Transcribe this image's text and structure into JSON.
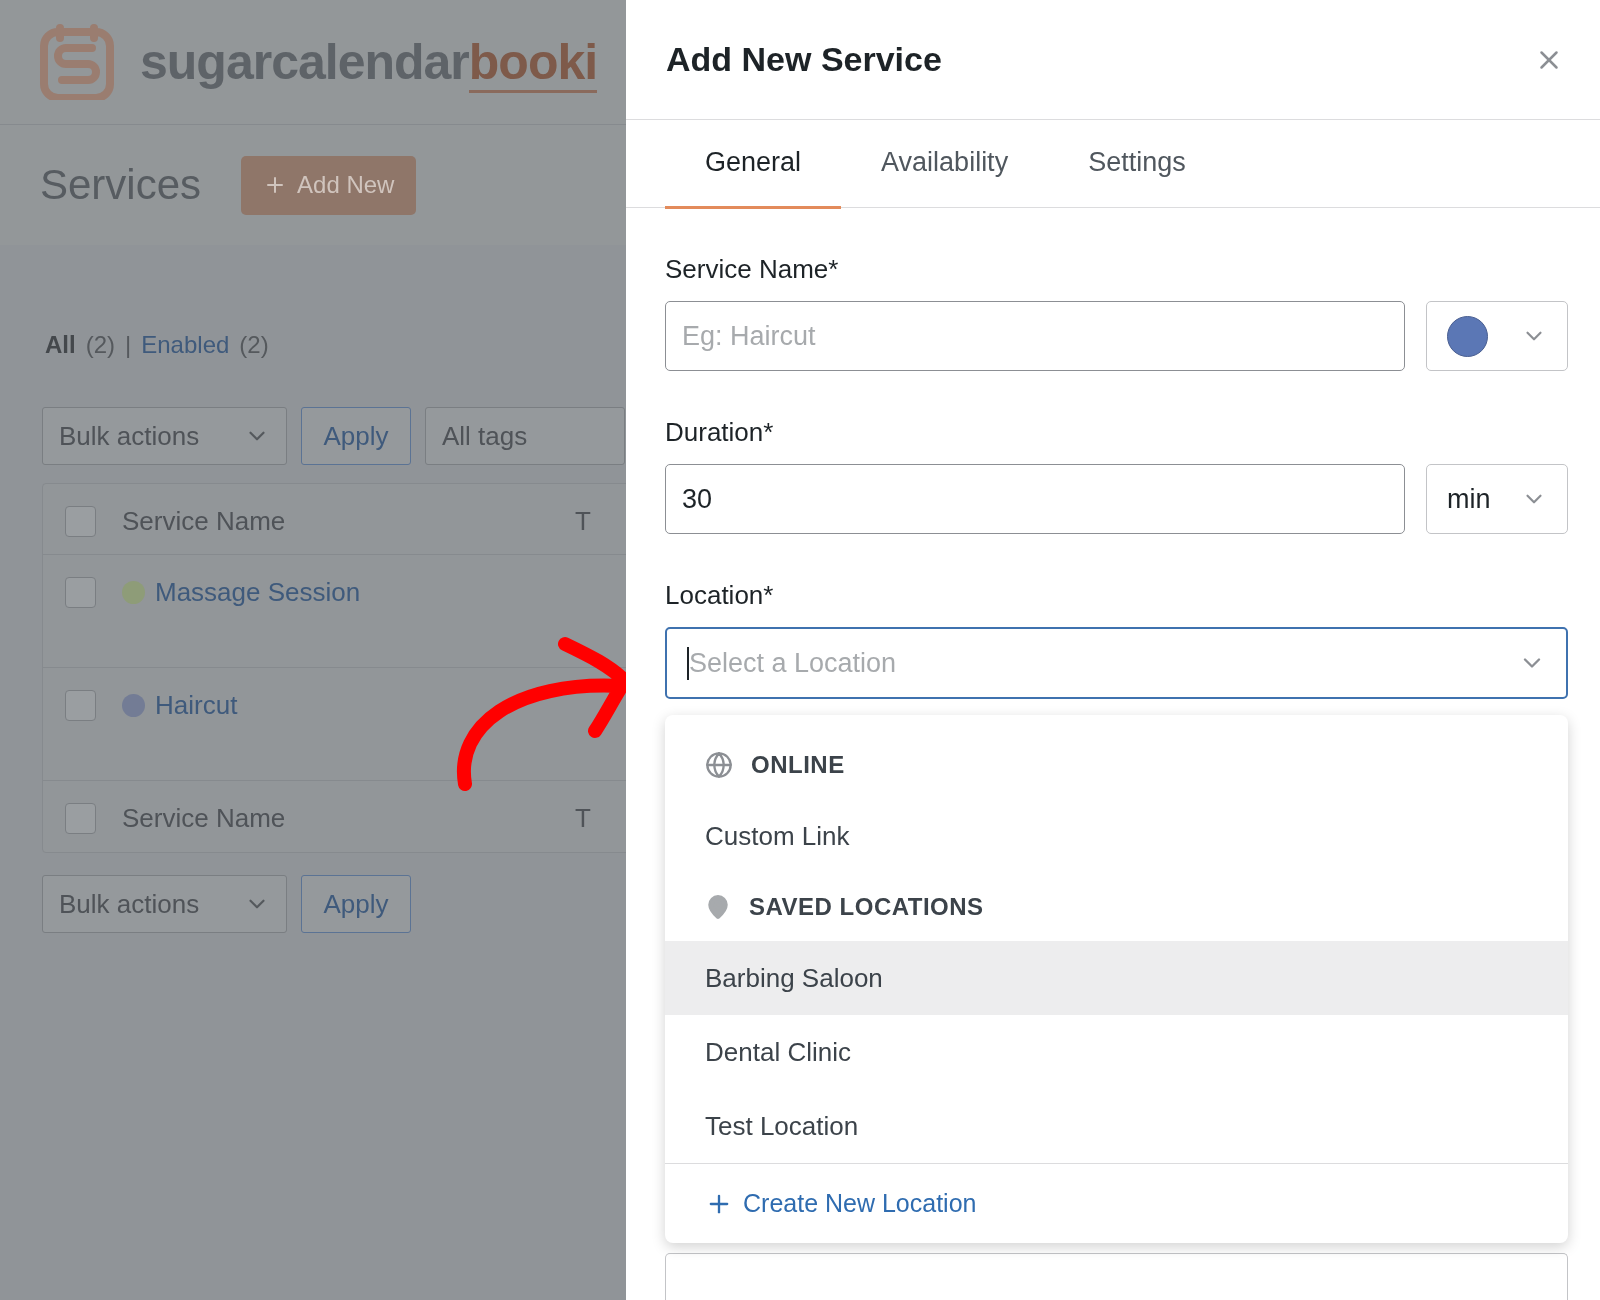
{
  "brand": {
    "name": "sugarcalendar",
    "accent": "booki"
  },
  "page": {
    "title": "Services",
    "add_button": "Add New"
  },
  "filters": [
    {
      "label": "All",
      "count": "(2)",
      "selected": true
    },
    {
      "label": "Enabled",
      "count": "(2)",
      "selected": false
    }
  ],
  "filter_separator": "|",
  "toolbar_top": {
    "bulk_actions": "Bulk actions",
    "apply": "Apply",
    "tags": "All tags"
  },
  "table": {
    "columns": [
      "Service Name",
      "T"
    ],
    "header_checked": false,
    "rows": [
      {
        "name": "Massage Session",
        "color": "#8e9c78",
        "checked": false
      },
      {
        "name": "Haircut",
        "color": "#737c95",
        "checked": false
      }
    ],
    "footer_columns": [
      "Service Name",
      "T"
    ],
    "footer_checked": false
  },
  "toolbar_bottom": {
    "bulk_actions": "Bulk actions",
    "apply": "Apply"
  },
  "panel": {
    "title": "Add New Service",
    "tabs": [
      {
        "label": "General",
        "selected": true
      },
      {
        "label": "Availability",
        "selected": false
      },
      {
        "label": "Settings",
        "selected": false
      }
    ],
    "service_name": {
      "label": "Service Name*",
      "placeholder": "Eg: Haircut",
      "color": "#5b77b5"
    },
    "duration": {
      "label": "Duration*",
      "value": "30",
      "unit": "min"
    },
    "location": {
      "label": "Location*",
      "placeholder": "Select a Location",
      "groups": [
        {
          "kind": "globe",
          "heading": "ONLINE",
          "options": [
            {
              "label": "Custom Link",
              "selected": false
            }
          ]
        },
        {
          "kind": "pin",
          "heading": "SAVED LOCATIONS",
          "options": [
            {
              "label": "Barbing Saloon",
              "selected": true
            },
            {
              "label": "Dental Clinic",
              "selected": false
            },
            {
              "label": "Test Location",
              "selected": false
            }
          ]
        }
      ],
      "create": "Create New Location"
    }
  }
}
